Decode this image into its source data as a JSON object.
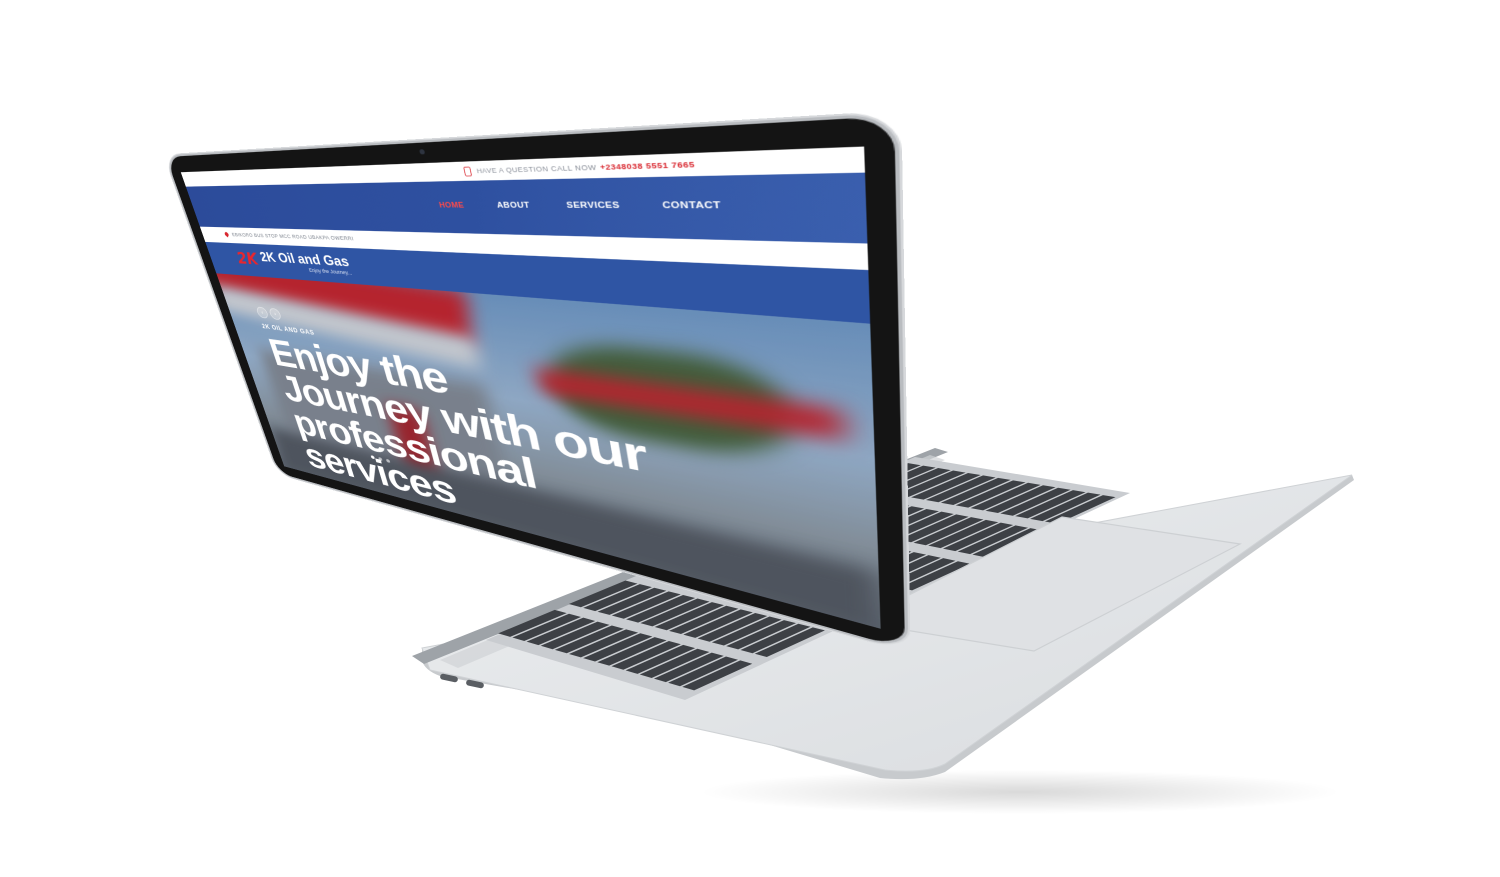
{
  "site": {
    "topbar": {
      "question_text": "HAVE A QUESTION CALL NOW",
      "phone": "+2348038 5551 7665"
    },
    "nav": {
      "items": [
        {
          "label": "HOME",
          "active": true
        },
        {
          "label": "ABOUT",
          "active": false
        },
        {
          "label": "SERVICES",
          "active": false
        },
        {
          "label": "CONTACT",
          "active": false
        }
      ]
    },
    "address": "EBIKORO BUS STOP MCC ROAD UBAKPA OWERRI",
    "logo": {
      "mark": "2K",
      "name": "2K Oil and Gas",
      "tagline": "Enjoy the Journey..."
    },
    "hero": {
      "kicker": "2K OIL AND GAS",
      "title": "Enjoy the Journey with our professional services",
      "prev_label": "‹",
      "next_label": "›",
      "slides": 3,
      "active_slide": 1
    }
  },
  "colors": {
    "brand_blue": "#2e50a0",
    "brand_red": "#e8262e"
  }
}
